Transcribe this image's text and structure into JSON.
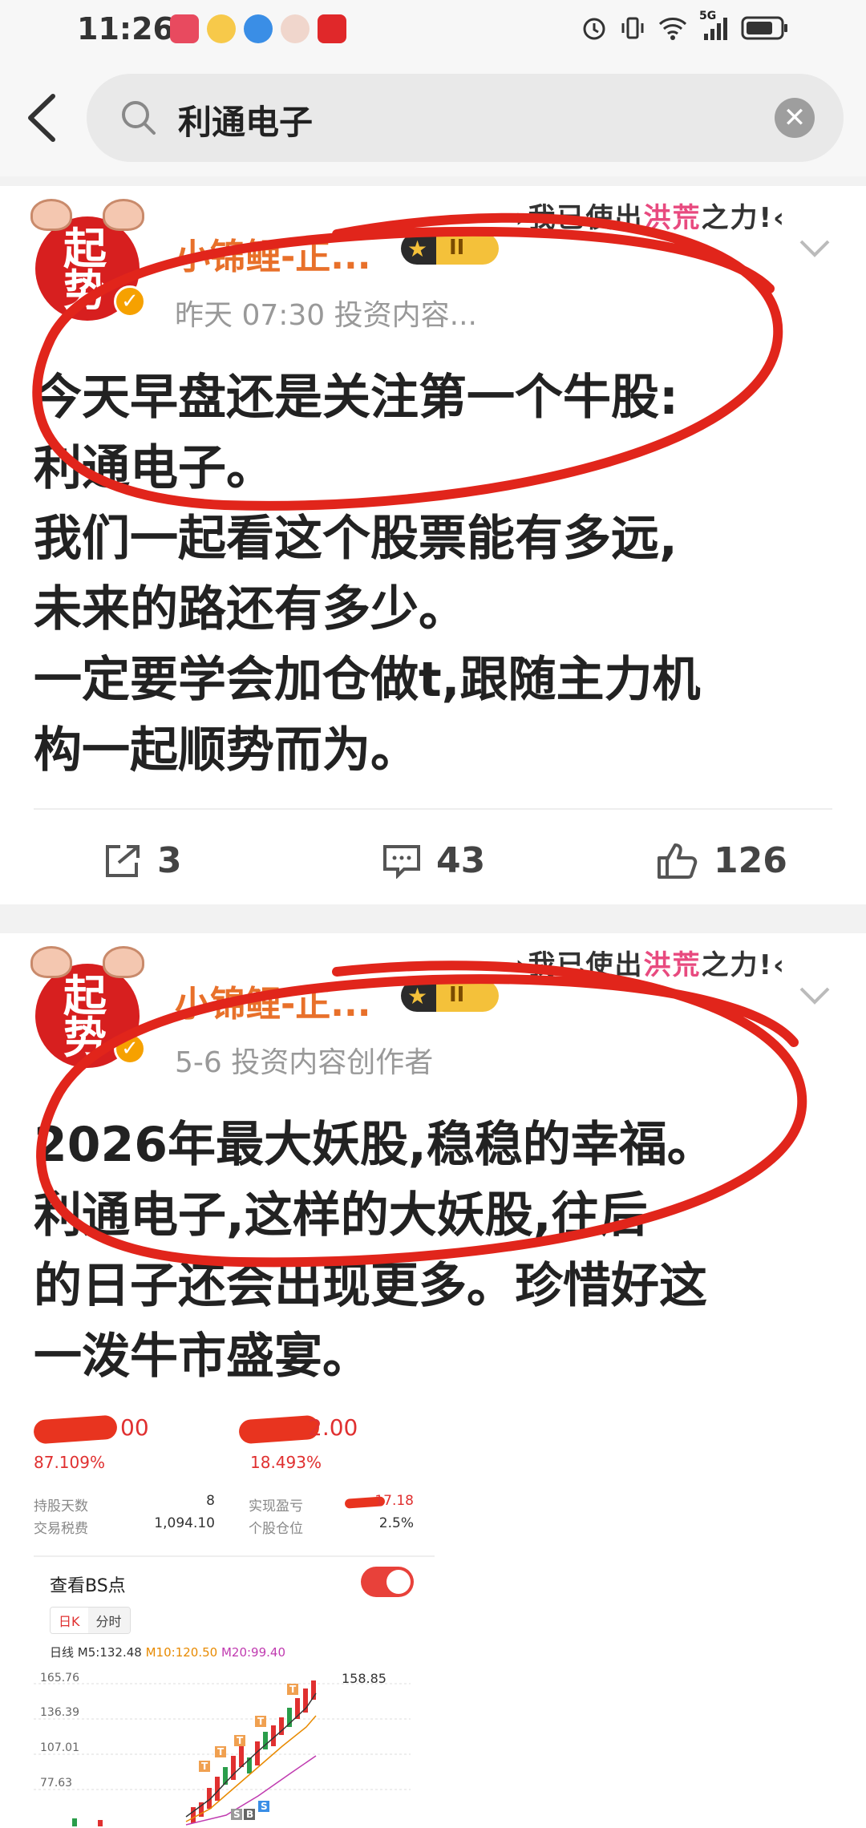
{
  "status": {
    "time": "11:26",
    "signal": "5G"
  },
  "search": {
    "query": "利通电子"
  },
  "posts": [
    {
      "author": "小锦鲤-正...",
      "avatar_text": "起势",
      "level": "II",
      "slogan_a": "我已使出",
      "slogan_b": "洪荒",
      "slogan_c": "之力!",
      "meta": "昨天 07:30  投资内容...",
      "lines": [
        "今天早盘还是关注第一个牛股:",
        "利通电子。",
        "我们一起看这个股票能有多远,",
        "未来的路还有多少。",
        "一定要学会加仓做t,跟随主力机",
        "构一起顺势而为。"
      ],
      "share_count": "3",
      "comment_count": "43",
      "like_count": "126"
    },
    {
      "author": "小锦鲤-正...",
      "avatar_text": "起势",
      "level": "II",
      "slogan_a": "我已使出",
      "slogan_b": "洪荒",
      "slogan_c": "之力!",
      "meta": "5-6  投资内容创作者",
      "lines": [
        "2026年最大妖股,稳稳的幸福。",
        "利通电子,这样的大妖股,往后",
        "的日子还会出现更多。珍惜好这",
        "一泼牛市盛宴。"
      ]
    }
  ],
  "stock": {
    "val1": "00",
    "pct1": "87.109%",
    "val2": "2.00",
    "pct2": "18.493%",
    "hold_days_label": "持股天数",
    "hold_days": "8",
    "fee_label": "交易税费",
    "fee": "1,094.10",
    "realized_label": "实现盈亏",
    "realized": "17.18",
    "position_label": "个股仓位",
    "position": "2.5%",
    "bs_title": "查看BS点",
    "tab_day": "日K",
    "tab_time": "分时",
    "ma_label": "日线",
    "ma5": "M5:132.48",
    "ma10": "M10:120.50",
    "ma20": "M20:99.40",
    "y_ticks": [
      "165.76",
      "136.39",
      "107.01",
      "77.63"
    ],
    "high_label": "158.85"
  }
}
